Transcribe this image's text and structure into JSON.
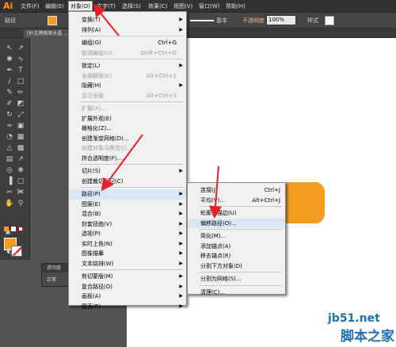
{
  "app": {
    "logo": "Ai"
  },
  "menubar": {
    "items": [
      "文件(F)",
      "编辑(E)",
      "对象(O)",
      "文字(T)",
      "选择(S)",
      "效果(C)",
      "视图(V)",
      "窗口(W)",
      "帮助(H)"
    ],
    "active": "对象(O)"
  },
  "controlbar": {
    "path_label": "路径",
    "stroke_style": "基本",
    "opacity_label": "不透明度",
    "opacity_value": "100%",
    "style_label": "样式"
  },
  "doc_tab": {
    "title": "[扑克牌图案水晶 ..."
  },
  "transparency_panel": {
    "title": "透明度",
    "mode": "正常"
  },
  "object_menu": {
    "items": [
      {
        "label": "变换(T)",
        "shortcut": "",
        "submenu": true,
        "disabled": false
      },
      {
        "label": "排列(A)",
        "shortcut": "",
        "submenu": true,
        "disabled": false
      },
      {
        "label": "编组(G)",
        "shortcut": "Ctrl+G",
        "submenu": false,
        "disabled": false
      },
      {
        "label": "取消编组(U)",
        "shortcut": "Shift+Ctrl+G",
        "submenu": false,
        "disabled": true
      },
      {
        "label": "锁定(L)",
        "shortcut": "",
        "submenu": true,
        "disabled": false
      },
      {
        "label": "全部解锁(K)",
        "shortcut": "Alt+Ctrl+2",
        "submenu": false,
        "disabled": true
      },
      {
        "label": "隐藏(H)",
        "shortcut": "",
        "submenu": true,
        "disabled": false
      },
      {
        "label": "显示全部",
        "shortcut": "Alt+Ctrl+3",
        "submenu": false,
        "disabled": true
      },
      {
        "label": "扩展(X)...",
        "shortcut": "",
        "submenu": false,
        "disabled": true
      },
      {
        "label": "扩展外观(E)",
        "shortcut": "",
        "submenu": false,
        "disabled": false
      },
      {
        "label": "栅格化(Z)...",
        "shortcut": "",
        "submenu": false,
        "disabled": false
      },
      {
        "label": "创建渐变网格(D)...",
        "shortcut": "",
        "submenu": false,
        "disabled": false
      },
      {
        "label": "创建对象马赛克(J)...",
        "shortcut": "",
        "submenu": false,
        "disabled": true
      },
      {
        "label": "拼合透明度(F)...",
        "shortcut": "",
        "submenu": false,
        "disabled": false
      },
      {
        "label": "切片(S)",
        "shortcut": "",
        "submenu": true,
        "disabled": false
      },
      {
        "label": "创建裁切标记(C)",
        "shortcut": "",
        "submenu": false,
        "disabled": false
      },
      {
        "label": "路径(P)",
        "shortcut": "",
        "submenu": true,
        "disabled": false
      },
      {
        "label": "图案(E)",
        "shortcut": "",
        "submenu": true,
        "disabled": false
      },
      {
        "label": "混合(B)",
        "shortcut": "",
        "submenu": true,
        "disabled": false
      },
      {
        "label": "封套扭曲(V)",
        "shortcut": "",
        "submenu": true,
        "disabled": false
      },
      {
        "label": "透视(P)",
        "shortcut": "",
        "submenu": true,
        "disabled": false
      },
      {
        "label": "实时上色(N)",
        "shortcut": "",
        "submenu": true,
        "disabled": false
      },
      {
        "label": "图像描摹",
        "shortcut": "",
        "submenu": true,
        "disabled": false
      },
      {
        "label": "文本绕排(W)",
        "shortcut": "",
        "submenu": true,
        "disabled": false
      },
      {
        "label": "剪切蒙版(M)",
        "shortcut": "",
        "submenu": true,
        "disabled": false
      },
      {
        "label": "复合路径(O)",
        "shortcut": "",
        "submenu": true,
        "disabled": false
      },
      {
        "label": "画板(A)",
        "shortcut": "",
        "submenu": true,
        "disabled": false
      },
      {
        "label": "图表(R)",
        "shortcut": "",
        "submenu": true,
        "disabled": false
      }
    ]
  },
  "path_submenu": {
    "items": [
      {
        "label": "连接(J)",
        "shortcut": "Ctrl+J"
      },
      {
        "label": "平均(V)...",
        "shortcut": "Alt+Ctrl+J"
      },
      {
        "label": "轮廓化描边(U)",
        "shortcut": ""
      },
      {
        "label": "偏移路径(O)...",
        "shortcut": ""
      },
      {
        "label": "简化(M)...",
        "shortcut": ""
      },
      {
        "label": "添加锚点(A)",
        "shortcut": ""
      },
      {
        "label": "移去锚点(R)",
        "shortcut": ""
      },
      {
        "label": "分割下方对象(D)",
        "shortcut": ""
      },
      {
        "label": "分割为网格(S)...",
        "shortcut": ""
      },
      {
        "label": "清理(C)...",
        "shortcut": ""
      }
    ]
  },
  "watermark": {
    "url": "jb51.net",
    "name": "脚本之家"
  },
  "colors": {
    "accent_orange": "#f39c1f",
    "arrow_red": "#e8202a",
    "watermark_blue": "#1f6fb5"
  }
}
